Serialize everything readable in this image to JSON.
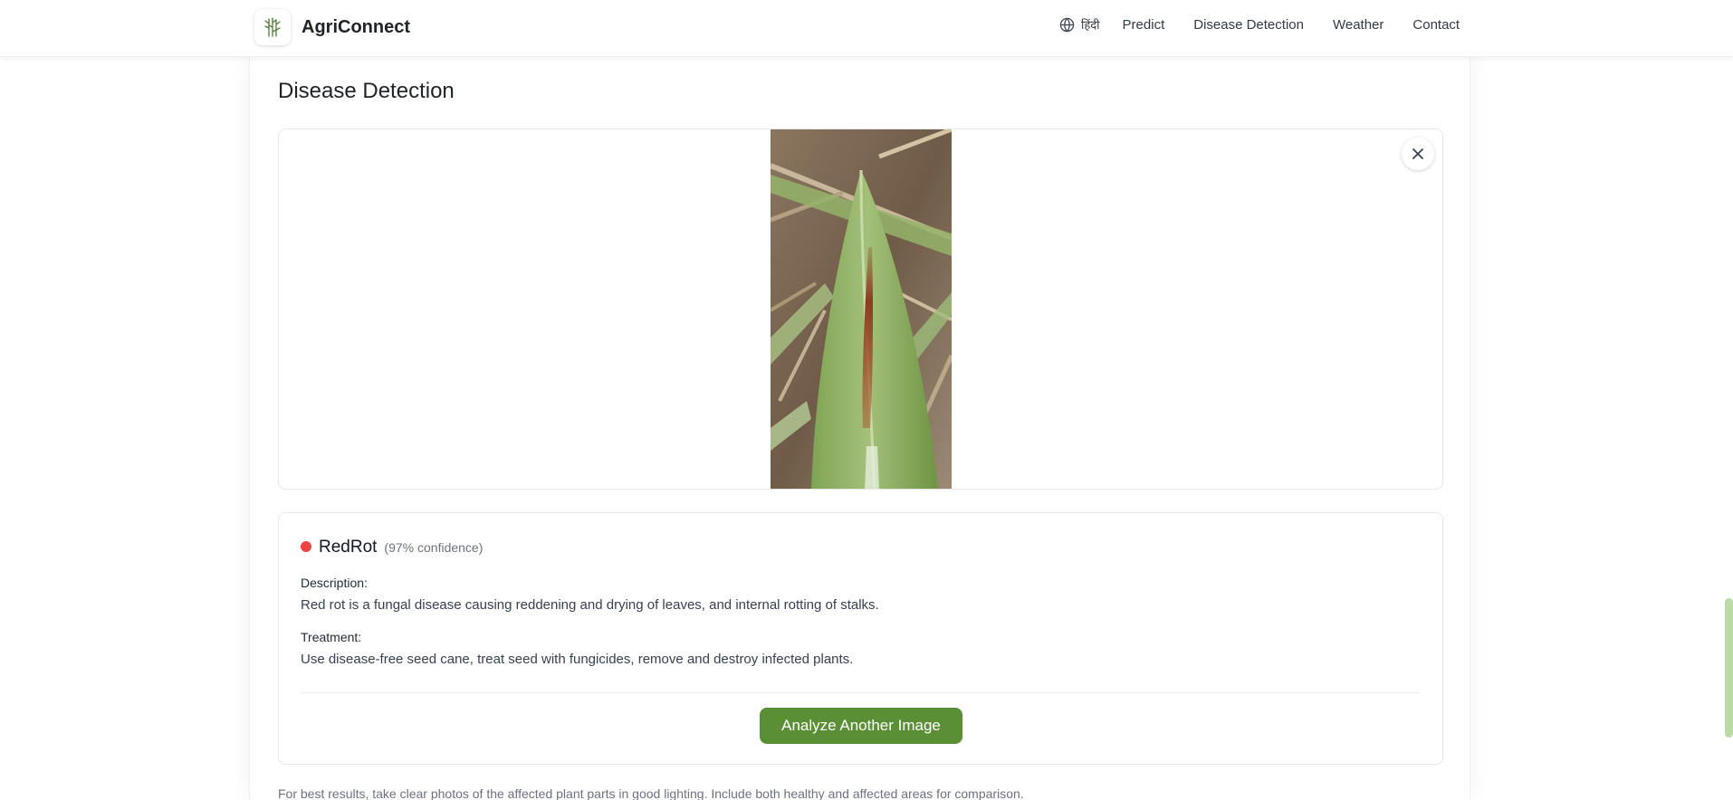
{
  "app": {
    "brand_name": "AgriConnect",
    "logo_icon": "sugarcane-plant-icon"
  },
  "nav": {
    "language_label": "हिंदी",
    "items": [
      {
        "label": "Predict"
      },
      {
        "label": "Disease Detection"
      },
      {
        "label": "Weather"
      },
      {
        "label": "Contact"
      }
    ]
  },
  "page": {
    "title": "Disease Detection"
  },
  "upload": {
    "image_subject": "sugarcane leaf with red rot lesion",
    "close_icon": "close-icon"
  },
  "result": {
    "disease": "RedRot",
    "confidence": "(97% confidence)",
    "status_color": "#ef4444",
    "description_label": "Description:",
    "description": "Red rot is a fungal disease causing reddening and drying of leaves, and internal rotting of stalks.",
    "treatment_label": "Treatment:",
    "treatment": "Use disease-free seed cane, treat seed with fungicides, remove and destroy infected plants.",
    "action_label": "Analyze Another Image"
  },
  "footer": {
    "tip": "For best results, take clear photos of the affected plant parts in good lighting. Include both healthy and affected areas for comparison."
  },
  "colors": {
    "accent": "#5a8f35",
    "scrollbar": "#b9dca5"
  }
}
